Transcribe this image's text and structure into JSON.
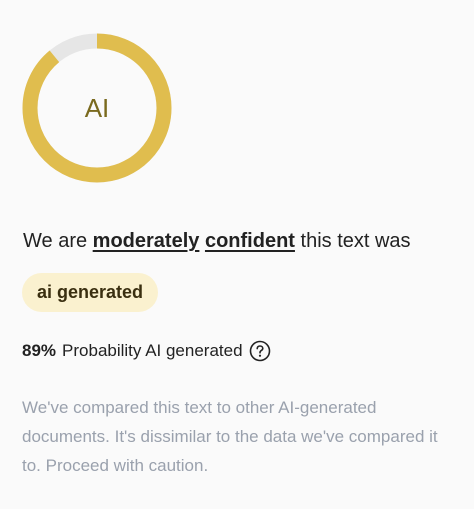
{
  "result": {
    "ring": {
      "label": "AI",
      "fill_fraction": 0.89,
      "fill_color": "#e0bd4e",
      "track_color": "#e6e6e6"
    },
    "headline": {
      "prefix": "We are",
      "emphasis_1": "moderately",
      "emphasis_2": "confident",
      "suffix": "this text was"
    },
    "badge": {
      "label": "ai generated",
      "bg_color": "#faf1cf"
    },
    "probability": {
      "percent": "89%",
      "label": "Probability AI generated",
      "help_icon": "question-circle-icon"
    },
    "description": "We've compared this text to other AI-generated documents. It's dissimilar to the data we've compared it to. Proceed with caution."
  }
}
